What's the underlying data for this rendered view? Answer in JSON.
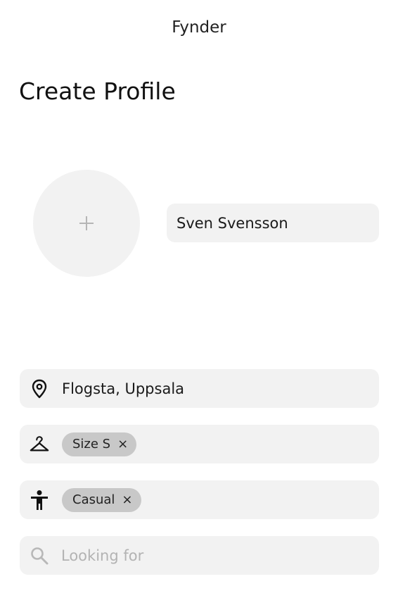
{
  "header": {
    "app_title": "Fynder"
  },
  "page": {
    "title": "Create Profile"
  },
  "avatar": {
    "icon": "plus-icon"
  },
  "name_field": {
    "value": "Sven Svensson"
  },
  "location": {
    "icon": "location-pin-icon",
    "value": "Flogsta, Uppsala"
  },
  "size": {
    "icon": "hanger-icon",
    "chips": [
      {
        "label": "Size S",
        "remove": "×"
      }
    ]
  },
  "style": {
    "icon": "person-icon",
    "chips": [
      {
        "label": "Casual",
        "remove": "×"
      }
    ]
  },
  "search": {
    "icon": "search-icon",
    "placeholder": "Looking for"
  },
  "colors": {
    "field_bg": "#f2f2f2",
    "chip_bg": "#c8c8c8",
    "placeholder": "#b3b3b3"
  }
}
